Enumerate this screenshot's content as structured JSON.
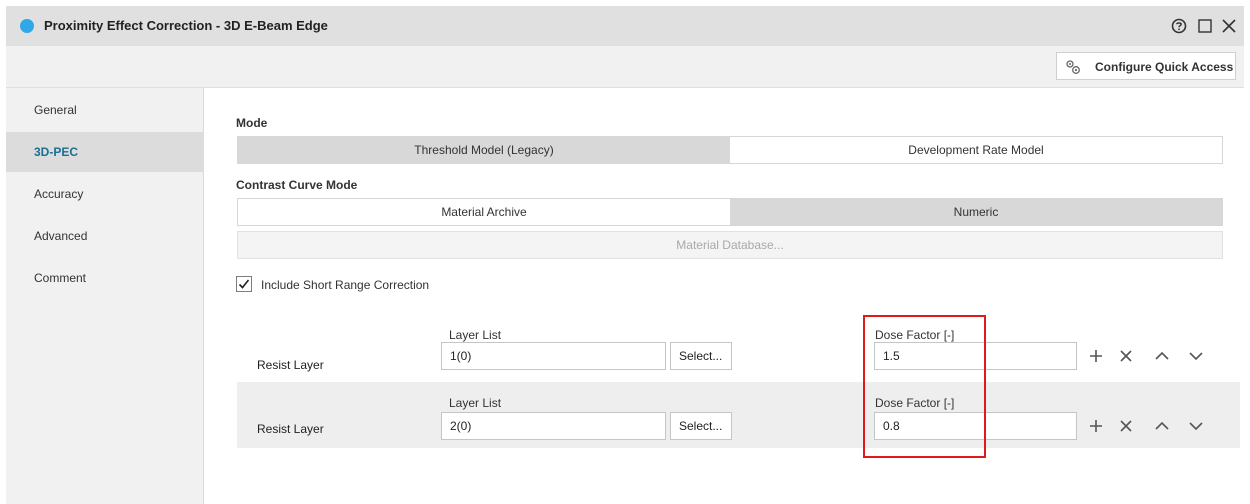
{
  "window": {
    "title": "Proximity Effect Correction - 3D E-Beam Edge",
    "title_dot_color": "#2fa8ea",
    "icons": [
      "help-icon",
      "maximize-icon",
      "close-icon"
    ]
  },
  "toolbar": {
    "configure_label": "Configure Quick Access",
    "configure_icon": "gears-icon"
  },
  "sidebar": {
    "active": "3D-PEC",
    "accent_color": "#1a6f93",
    "items": [
      {
        "label": "General"
      },
      {
        "label": "3D-PEC"
      },
      {
        "label": "Accuracy"
      },
      {
        "label": "Advanced"
      },
      {
        "label": "Comment"
      }
    ]
  },
  "mode": {
    "label": "Mode",
    "options": [
      "Threshold Model (Legacy)",
      "Development Rate Model"
    ],
    "selected": "Threshold Model (Legacy)"
  },
  "contrast": {
    "label": "Contrast Curve Mode",
    "options": [
      "Material Archive",
      "Numeric"
    ],
    "selected": "Numeric"
  },
  "material_db_label": "Material Database...",
  "short_range": {
    "label": "Include Short Range Correction",
    "checked": true
  },
  "layers": [
    {
      "label": "Resist Layer",
      "layer_list_label": "Layer List",
      "layer_list_value": "1(0)",
      "select_label": "Select...",
      "dose_label": "Dose Factor [-]",
      "dose_value": "1.5"
    },
    {
      "label": "Resist Layer",
      "layer_list_label": "Layer List",
      "layer_list_value": "2(0)",
      "select_label": "Select...",
      "dose_label": "Dose Factor [-]",
      "dose_value": "0.8"
    }
  ],
  "row_actions": [
    "add-icon",
    "remove-icon",
    "move-up-icon",
    "move-down-icon"
  ],
  "highlight_color": "#e0191b"
}
